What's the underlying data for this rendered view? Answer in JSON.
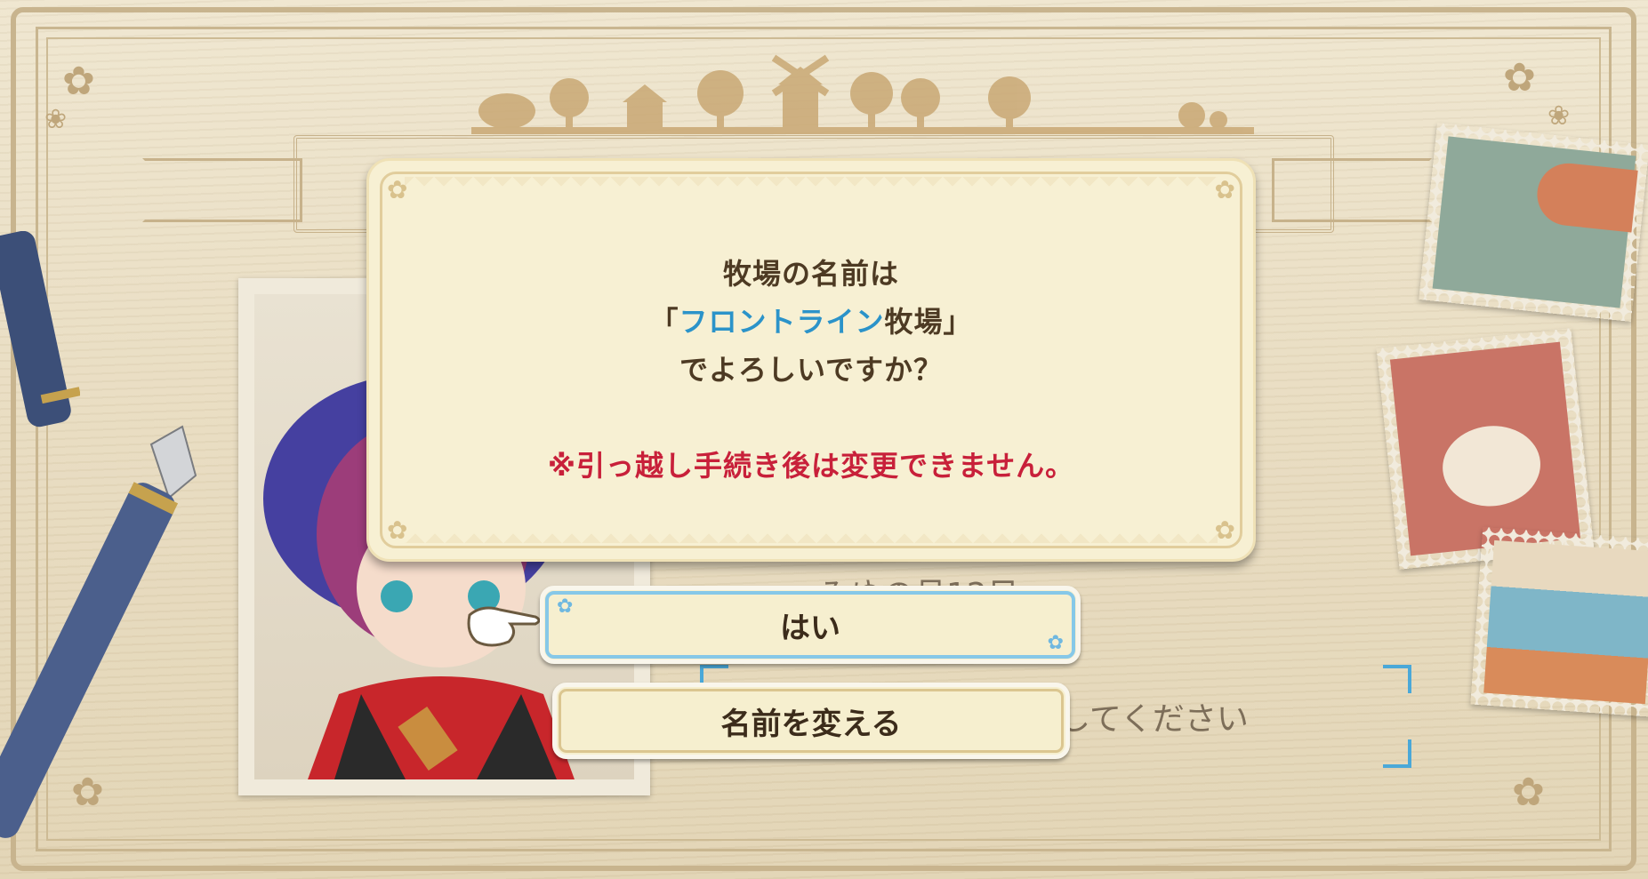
{
  "dialog": {
    "line1": "牧場の名前は",
    "open_bracket": "「",
    "farm_name": "フロントライン",
    "line2_suffix": "牧場」",
    "line3": "でよろしいですか？",
    "warning": "※引っ越し手続き後は変更できません。"
  },
  "buttons": {
    "yes": "はい",
    "change_name": "名前を変える"
  },
  "background": {
    "date_text": "みゆの月12日",
    "input_hint": "してください"
  },
  "colors": {
    "farm_name": "#2b93c9",
    "warning": "#c8203a",
    "dialog_bg": "#f7f0d3",
    "selected_outline": "#86c8e8"
  }
}
